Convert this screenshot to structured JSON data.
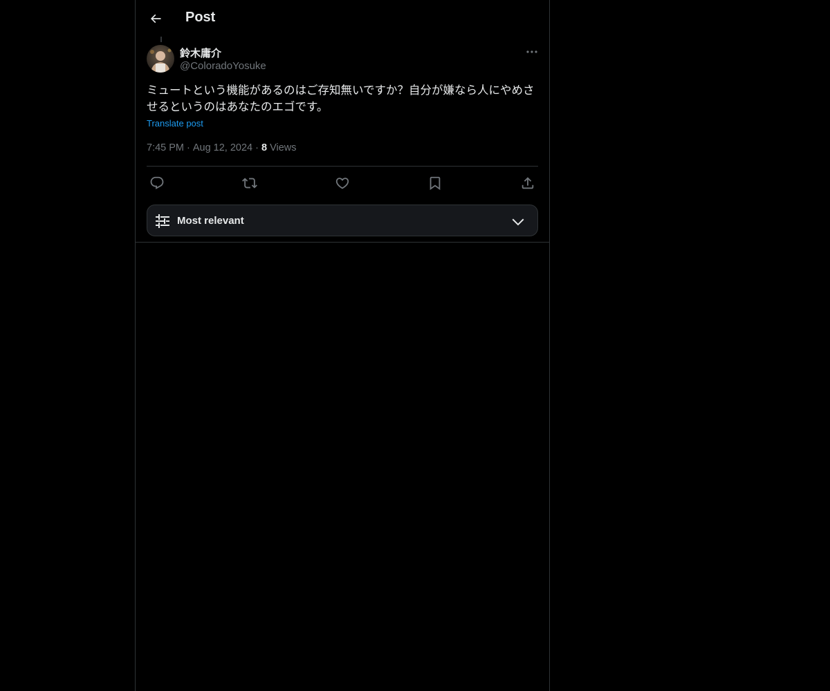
{
  "header": {
    "title": "Post"
  },
  "post": {
    "display_name": "鈴木庸介",
    "handle": "@ColoradoYosuke",
    "text": "ミュートという機能があるのはご存知無いですか？自分が嫌なら人にやめさせるというのはあなたのエゴです。",
    "translate_label": "Translate post",
    "time": "7:45 PM",
    "date": "Aug 12, 2024",
    "views_count": "8",
    "views_label": "Views",
    "separator": "·"
  },
  "sort": {
    "label": "Most relevant"
  },
  "colors": {
    "background": "#000000",
    "text_primary": "#e7e9ea",
    "text_secondary": "#71767b",
    "accent": "#1d9bf0",
    "border": "#2f3336"
  }
}
